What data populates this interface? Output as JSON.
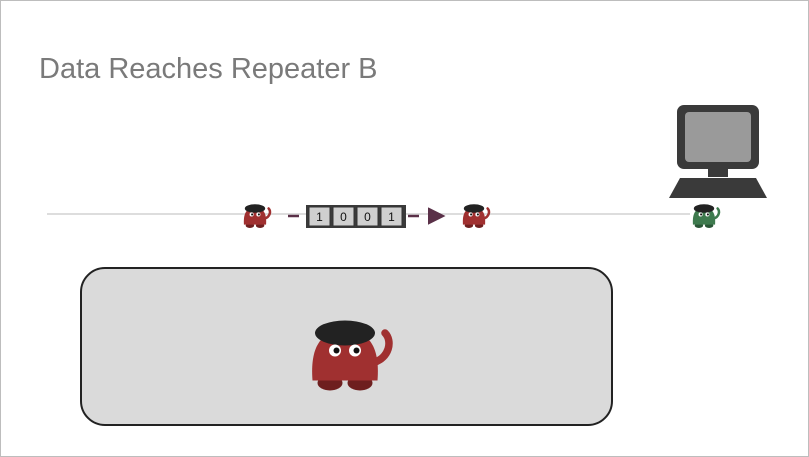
{
  "slide": {
    "title": "Data Reaches Repeater B"
  },
  "packet": {
    "bits": [
      "1",
      "0",
      "0",
      "1"
    ]
  },
  "colors": {
    "repeater": "#a03030",
    "repeater_dark": "#6e1f1f",
    "receiver": "#3e7a4e",
    "receiver_dark": "#2a5536",
    "hat": "#222222",
    "wire": "#dddddd",
    "arrow": "#5a3048",
    "panel_fill": "#dadada",
    "panel_stroke": "#222222",
    "computer": "#3a3a3a",
    "screen": "#9a9a9a"
  },
  "icons": {
    "repeater_a": "monster-icon",
    "repeater_b": "monster-icon",
    "receiver": "monster-icon",
    "computer": "computer-icon",
    "zoom_repeater": "monster-icon"
  }
}
